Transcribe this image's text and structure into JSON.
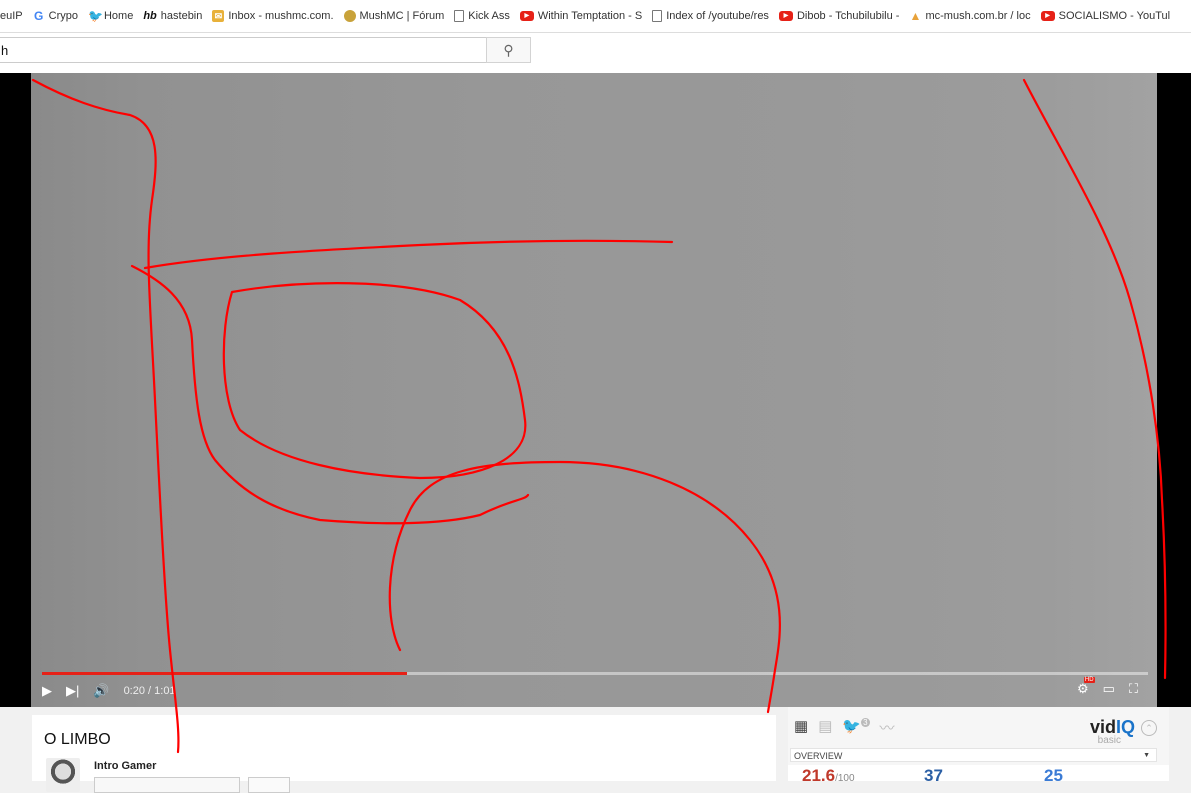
{
  "bookmarks": [
    {
      "label": "euIP",
      "icon": "none"
    },
    {
      "label": "Crypo",
      "icon": "google-icon"
    },
    {
      "label": "Home",
      "icon": "twitter-bird-icon"
    },
    {
      "label": "hastebin",
      "icon": "hastebin-icon"
    },
    {
      "label": "Inbox - mushmc.com.",
      "icon": "mail-icon"
    },
    {
      "label": "MushMC | Fórum",
      "icon": "mushmc-icon"
    },
    {
      "label": "Kick Ass",
      "icon": "page-icon"
    },
    {
      "label": "Within Temptation - S",
      "icon": "youtube-icon"
    },
    {
      "label": "Index of /youtube/res",
      "icon": "page-icon"
    },
    {
      "label": "Dibob - Tchubilubilu -",
      "icon": "youtube-icon"
    },
    {
      "label": "mc-mush.com.br / loc",
      "icon": "mc-icon"
    },
    {
      "label": "SOCIALISMO - YouTul",
      "icon": "youtube-icon"
    }
  ],
  "search": {
    "value": "h",
    "button_icon": "search-icon"
  },
  "player": {
    "progress": 0.33,
    "time": "0:20 / 1:01",
    "progress_color": "#e62117"
  },
  "video": {
    "title": "O LIMBO",
    "channel": "Intro Gamer"
  },
  "vidiq": {
    "logo_a": "vid",
    "logo_b": "IQ",
    "tier": "basic",
    "notif_count": "3",
    "section": "OVERVIEW",
    "score": "21.6",
    "score_suffix": "/100",
    "stat2": "37",
    "stat3": "25"
  },
  "annotation_color": "#ff0000"
}
